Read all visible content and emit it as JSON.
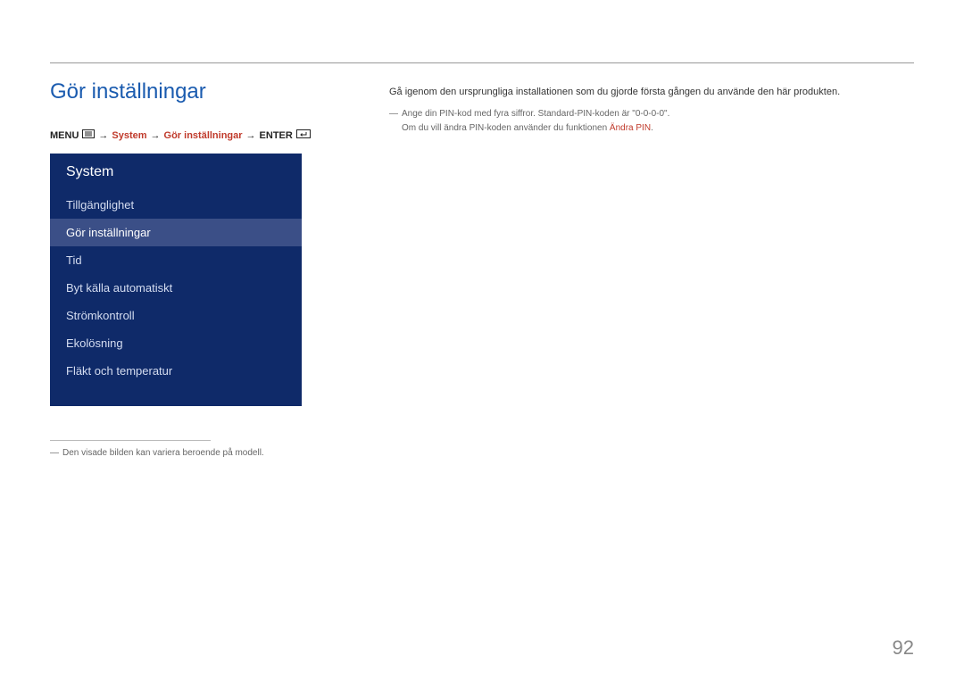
{
  "page_title": "Gör inställningar",
  "breadcrumb": {
    "menu_label": "MENU",
    "sep": "→",
    "system": "System",
    "item": "Gör inställningar",
    "enter_label": "ENTER"
  },
  "menu_panel": {
    "header": "System",
    "items": [
      {
        "label": "Tillgänglighet",
        "selected": false
      },
      {
        "label": "Gör inställningar",
        "selected": true
      },
      {
        "label": "Tid",
        "selected": false
      },
      {
        "label": "Byt källa automatiskt",
        "selected": false
      },
      {
        "label": "Strömkontroll",
        "selected": false
      },
      {
        "label": "Ekolösning",
        "selected": false
      },
      {
        "label": "Fläkt och temperatur",
        "selected": false
      }
    ]
  },
  "left_footnote": "Den visade bilden kan variera beroende på modell.",
  "right": {
    "body": "Gå igenom den ursprungliga installationen som du gjorde första gången du använde den här produkten.",
    "note_line1": "Ange din PIN-kod med fyra siffror. Standard-PIN-koden är \"0-0-0-0\".",
    "note_line2_a": "Om du vill ändra PIN-koden använder du funktionen ",
    "note_line2_link": "Ändra PIN",
    "note_line2_b": "."
  },
  "page_number": "92",
  "dash": "―"
}
